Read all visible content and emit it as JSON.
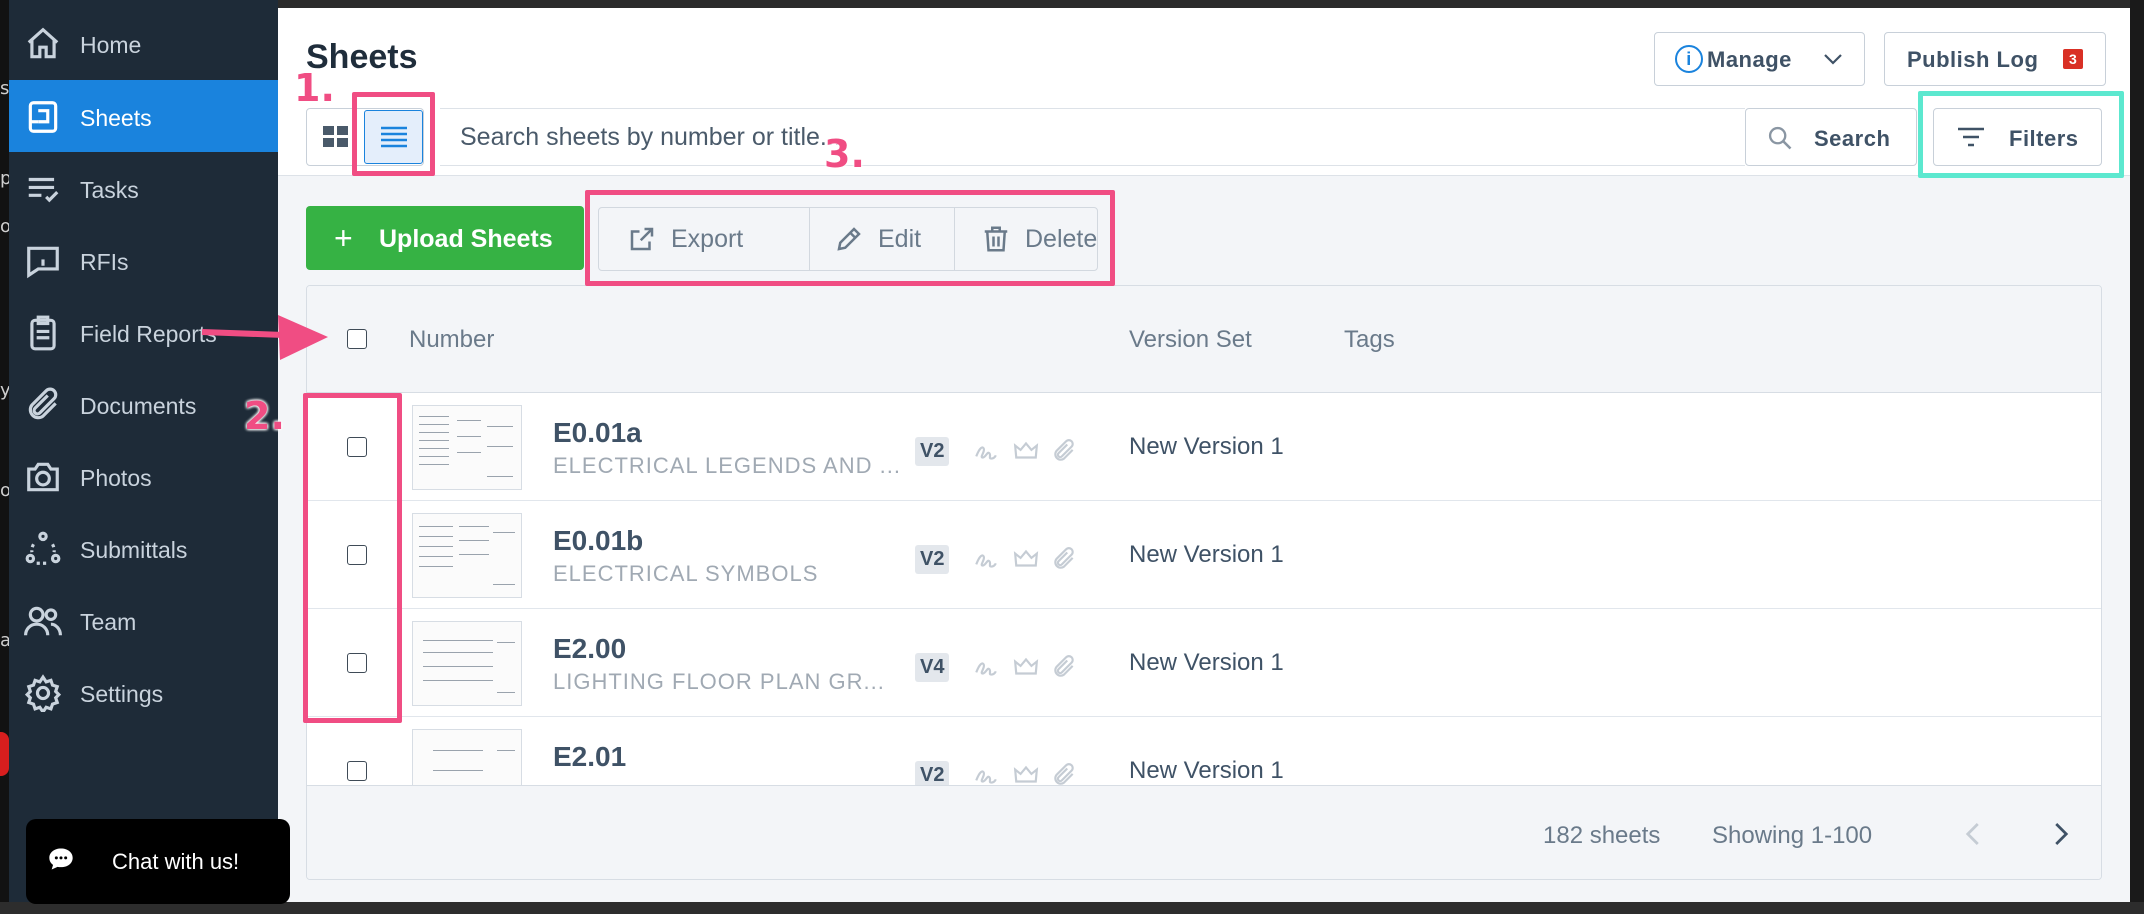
{
  "sidebar": {
    "items": [
      {
        "label": "Home",
        "icon": "home-icon"
      },
      {
        "label": "Sheets",
        "icon": "sheets-icon",
        "active": true
      },
      {
        "label": "Tasks",
        "icon": "tasks-icon"
      },
      {
        "label": "RFIs",
        "icon": "rfi-icon"
      },
      {
        "label": "Field Reports",
        "icon": "clipboard-icon"
      },
      {
        "label": "Documents",
        "icon": "paperclip-icon"
      },
      {
        "label": "Photos",
        "icon": "camera-icon"
      },
      {
        "label": "Submittals",
        "icon": "submittals-icon"
      },
      {
        "label": "Team",
        "icon": "team-icon"
      },
      {
        "label": "Settings",
        "icon": "gear-icon"
      }
    ]
  },
  "header": {
    "title": "Sheets",
    "manage_label": "Manage",
    "publish_log_label": "Publish Log",
    "publish_log_count": "3"
  },
  "search": {
    "placeholder": "Search sheets by number or title...",
    "button_label": "Search",
    "filters_label": "Filters"
  },
  "actions": {
    "upload_label": "Upload Sheets",
    "upload_plus": "+",
    "export_label": "Export",
    "edit_label": "Edit",
    "delete_label": "Delete"
  },
  "table": {
    "columns": {
      "number": "Number",
      "version_set": "Version Set",
      "tags": "Tags"
    },
    "rows": [
      {
        "number": "E0.01a",
        "title": "ELECTRICAL LEGENDS AND ...",
        "version": "V2",
        "version_set": "New Version 1"
      },
      {
        "number": "E0.01b",
        "title": "ELECTRICAL SYMBOLS",
        "version": "V2",
        "version_set": "New Version 1"
      },
      {
        "number": "E2.00",
        "title": "LIGHTING FLOOR PLAN GR...",
        "version": "V4",
        "version_set": "New Version 1"
      },
      {
        "number": "E2.01",
        "title": "",
        "version": "V2",
        "version_set": "New Version 1"
      }
    ],
    "footer": {
      "count": "182 sheets",
      "showing": "Showing 1-100"
    }
  },
  "chat": {
    "label": "Chat with us!"
  },
  "annotations": {
    "one": "1.",
    "two": "2.",
    "three": "3."
  },
  "colors": {
    "sidebar_bg": "#1e2b38",
    "active": "#1a83dd",
    "upload": "#36b244",
    "annotation_pink": "#f04d83",
    "annotation_teal": "#5ce8cf",
    "badge": "#d93025"
  }
}
